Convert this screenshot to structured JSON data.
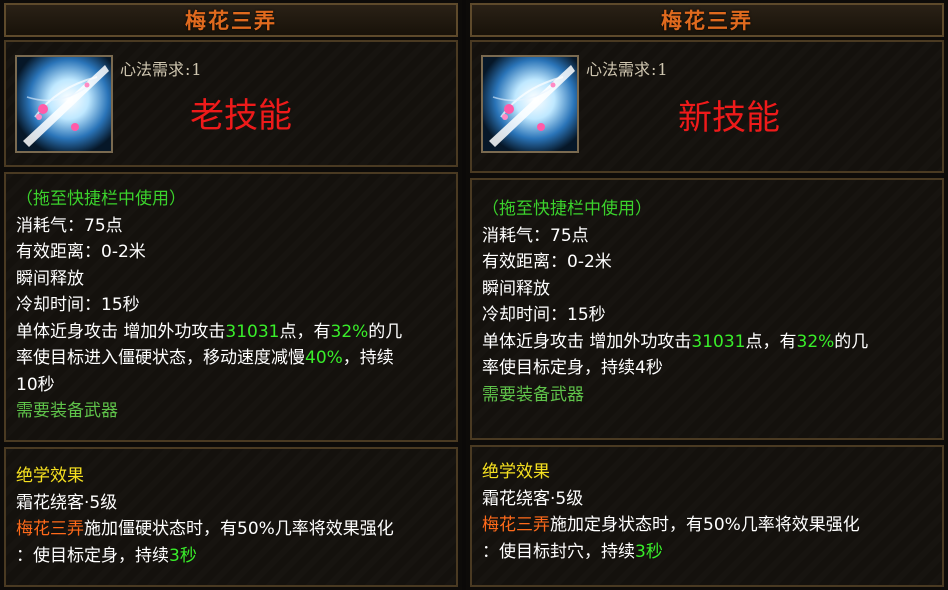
{
  "left": {
    "title": "梅花三弄",
    "requirement_label": "心法需求",
    "requirement_sep": ":",
    "requirement_value": "1",
    "version_label": "老技能",
    "usage": "（拖至快捷栏中使用）",
    "cost_label": "消耗气：",
    "cost_value": "75点",
    "range_label": "有效距离：",
    "range_value": "0-2米",
    "cast": "瞬间释放",
    "cooldown_label": "冷却时间：",
    "cooldown_value": "15秒",
    "desc_part1": "单体近身攻击 增加外功攻击",
    "desc_dmg": "31031",
    "desc_part2": "点，有",
    "desc_pct": "32%",
    "desc_part3": "的几",
    "desc_line2_a": "率使目标进入僵硬状态，移动速度减慢",
    "desc_slow": "40%",
    "desc_line2_b": "，持续",
    "desc_line3": "10秒",
    "weapon_req": "需要装备武器",
    "effect_heading": "绝学效果",
    "effect_skill": "霜花绕客·5级",
    "effect_name": "梅花三弄",
    "effect_text1": "施加僵硬状态时，有50%几率将效果强化",
    "effect_text2_a": "：使目标定身，持续",
    "effect_text2_b": "3秒"
  },
  "right": {
    "title": "梅花三弄",
    "requirement_label": "心法需求",
    "requirement_sep": ":",
    "requirement_value": "1",
    "version_label": "新技能",
    "usage": "（拖至快捷栏中使用）",
    "cost_label": "消耗气：",
    "cost_value": "75点",
    "range_label": "有效距离：",
    "range_value": "0-2米",
    "cast": "瞬间释放",
    "cooldown_label": "冷却时间：",
    "cooldown_value": "15秒",
    "desc_part1": "单体近身攻击 增加外功攻击",
    "desc_dmg": "31031",
    "desc_part2": "点，有",
    "desc_pct": "32%",
    "desc_part3": "的几",
    "desc_line2": "率使目标定身，持续4秒",
    "weapon_req": "需要装备武器",
    "effect_heading": "绝学效果",
    "effect_skill": "霜花绕客·5级",
    "effect_name": "梅花三弄",
    "effect_text1": "施加定身状态时，有50%几率将效果强化",
    "effect_text2_a": "：使目标封穴，持续",
    "effect_text2_b": "3秒"
  }
}
